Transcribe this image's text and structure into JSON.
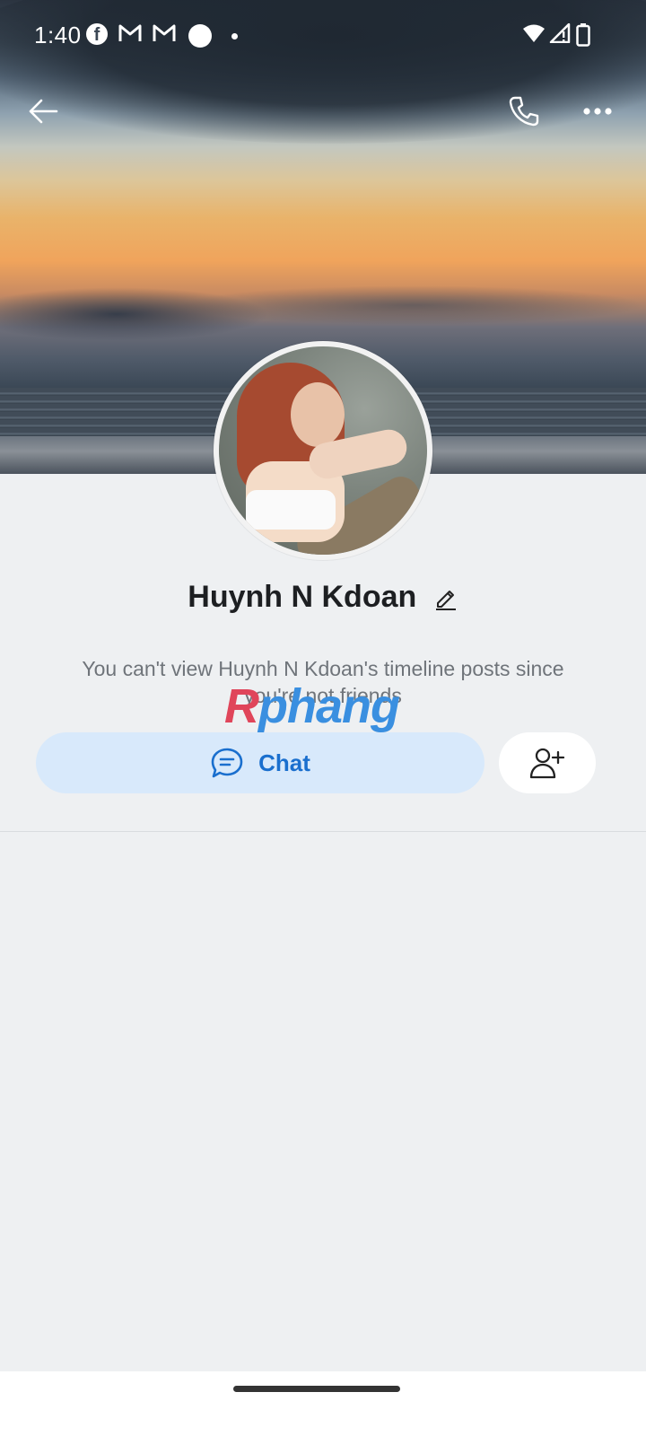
{
  "status_bar": {
    "time": "1:40",
    "left_icons": [
      "facebook-icon",
      "gmail-icon",
      "gmail-icon",
      "circle-icon",
      "dot-icon"
    ],
    "right_icons": [
      "wifi-icon",
      "signal-icon",
      "battery-icon"
    ]
  },
  "header": {
    "icons": [
      "back-arrow-icon",
      "phone-icon",
      "more-icon"
    ]
  },
  "profile": {
    "name": "Huynh N Kdoan",
    "notice": "You can't view Huynh N Kdoan's timeline posts since you're not friends"
  },
  "actions": {
    "chat_label": "Chat",
    "add_friend_icon": "add-friend-icon"
  },
  "watermark": {
    "part1": "R",
    "part2": "phang"
  },
  "colors": {
    "accent": "#1a6fce",
    "chat_bg": "#d8e9fb",
    "page_bg": "#eef0f2"
  }
}
